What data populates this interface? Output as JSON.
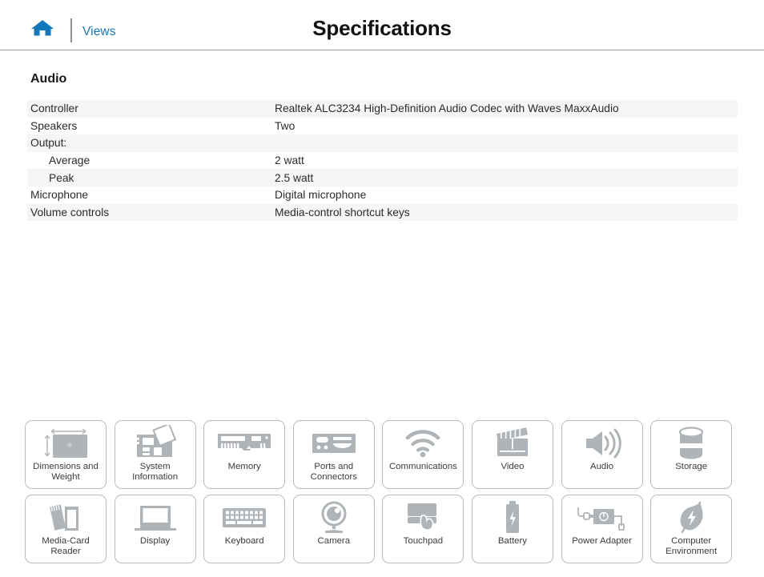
{
  "header": {
    "home_icon": "home-icon",
    "views_label": "Views",
    "title": "Specifications",
    "accent_color": "#1278be",
    "divider_color": "#9a9a9a"
  },
  "spec": {
    "section_title": "Audio",
    "row_stripe_color": "#f5f5f5",
    "rows": [
      {
        "label": "Controller",
        "value": "Realtek ALC3234 High-Definition Audio Codec with Waves MaxxAudio",
        "indent": false
      },
      {
        "label": "Speakers",
        "value": "Two",
        "indent": false
      },
      {
        "label": "Output:",
        "value": "",
        "indent": false
      },
      {
        "label": "Average",
        "value": "2 watt",
        "indent": true
      },
      {
        "label": "Peak",
        "value": "2.5 watt",
        "indent": true
      },
      {
        "label": "Microphone",
        "value": "Digital microphone",
        "indent": false
      },
      {
        "label": "Volume controls",
        "value": "Media-control shortcut keys",
        "indent": false
      }
    ]
  },
  "tiles": {
    "icon_color": "#aeb4b8",
    "border_color": "#b9bcbe",
    "rows": [
      [
        {
          "label": "Dimensions and\nWeight",
          "icon": "laptop-dimensions-icon"
        },
        {
          "label": "System\nInformation",
          "icon": "motherboard-icon"
        },
        {
          "label": "Memory",
          "icon": "memory-module-icon"
        },
        {
          "label": "Ports and\nConnectors",
          "icon": "ports-connectors-icon"
        },
        {
          "label": "Communications",
          "icon": "wifi-icon"
        },
        {
          "label": "Video",
          "icon": "clapperboard-icon"
        },
        {
          "label": "Audio",
          "icon": "speaker-icon"
        },
        {
          "label": "Storage",
          "icon": "storage-drive-icon"
        }
      ],
      [
        {
          "label": "Media-Card\nReader",
          "icon": "media-card-icon"
        },
        {
          "label": "Display",
          "icon": "display-icon"
        },
        {
          "label": "Keyboard",
          "icon": "keyboard-icon"
        },
        {
          "label": "Camera",
          "icon": "camera-icon"
        },
        {
          "label": "Touchpad",
          "icon": "touchpad-icon"
        },
        {
          "label": "Battery",
          "icon": "battery-icon"
        },
        {
          "label": "Power Adapter",
          "icon": "power-adapter-icon"
        },
        {
          "label": "Computer\nEnvironment",
          "icon": "leaf-icon"
        }
      ]
    ]
  }
}
